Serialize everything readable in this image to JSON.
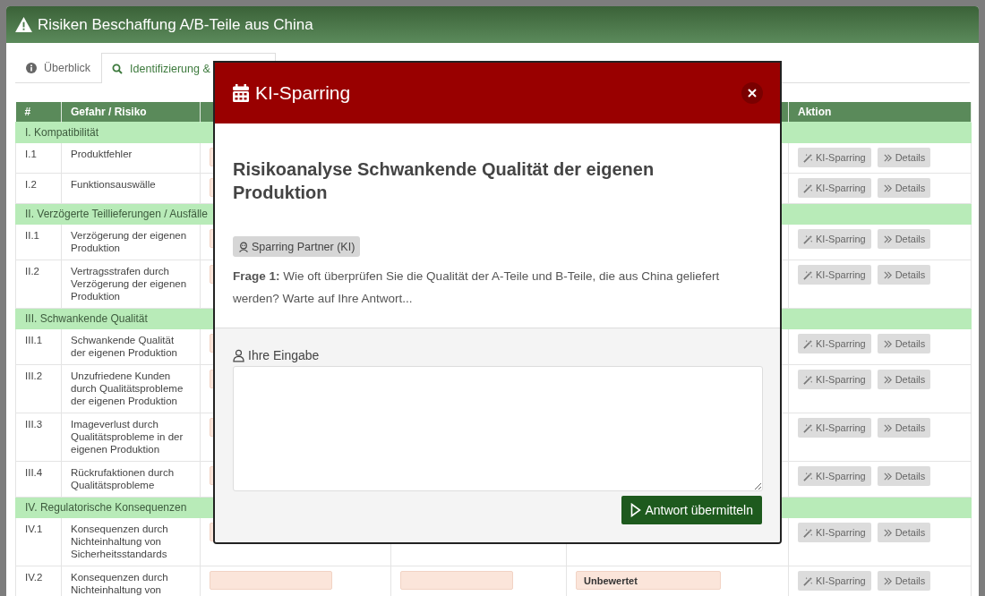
{
  "window": {
    "title": "Risiken Beschaffung A/B-Teile aus China"
  },
  "tabs": [
    {
      "label": "Überblick",
      "selected": false
    },
    {
      "label": "Identifizierung &",
      "selected": true
    }
  ],
  "table": {
    "columns": [
      "#",
      "Gefahr / Risiko",
      "Aktion"
    ],
    "groups": [
      {
        "title": "I. Kompatibilität",
        "rows": [
          {
            "id": "I.1",
            "risk": "Produktfehler",
            "actions": [
              "KI-Sparring",
              "Details"
            ]
          },
          {
            "id": "I.2",
            "risk": "Funktionsauswälle",
            "actions": [
              "KI-Sparring",
              "Details"
            ]
          }
        ]
      },
      {
        "title": "II. Verzögerte Teillieferungen / Ausfälle",
        "rows": [
          {
            "id": "II.1",
            "risk": "Verzögerung der eigenen Produktion",
            "actions": [
              "KI-Sparring",
              "Details"
            ]
          },
          {
            "id": "II.2",
            "risk": "Vertragsstrafen durch Verzögerung der eigenen Produktion",
            "actions": [
              "KI-Sparring",
              "Details"
            ]
          }
        ]
      },
      {
        "title": "III. Schwankende Qualität",
        "rows": [
          {
            "id": "III.1",
            "risk": "Schwankende Qualität der eigenen Produktion",
            "actions": [
              "KI-Sparring",
              "Details"
            ]
          },
          {
            "id": "III.2",
            "risk": "Unzufriedene Kunden durch Qualitätsprobleme der eigenen Produktion",
            "actions": [
              "KI-Sparring",
              "Details"
            ]
          },
          {
            "id": "III.3",
            "risk": "Imageverlust durch Qualitätsprobleme in der eigenen Produktion",
            "actions": [
              "KI-Sparring",
              "Details"
            ]
          },
          {
            "id": "III.4",
            "risk": "Rückrufaktionen durch Qualitätsprobleme",
            "actions": [
              "KI-Sparring",
              "Details"
            ]
          }
        ]
      },
      {
        "title": "IV. Regulatorische Konsequenzen",
        "rows": [
          {
            "id": "IV.1",
            "risk": "Konsequenzen durch Nichteinhaltung von Sicherheitsstandards",
            "actions": [
              "KI-Sparring",
              "Details"
            ]
          },
          {
            "id": "IV.2",
            "risk": "Konsequenzen durch Nichteinhaltung von",
            "rating": "Unbewertet",
            "actions": [
              "KI-Sparring",
              "Details"
            ]
          }
        ]
      }
    ]
  },
  "dialog": {
    "title": "KI-Sparring",
    "heading": "Risikoanalyse Schwankende Qualität der eigenen Produktion",
    "badge": "Sparring Partner (KI)",
    "message": "**Frage 1:** Wie oft überprüfen Sie die Qualität der A-Teile und B-Teile, die aus China geliefert werden? Warte auf Ihre Antwort...",
    "input_label": "Ihre Eingabe",
    "submit": "Antwort übermitteln"
  }
}
